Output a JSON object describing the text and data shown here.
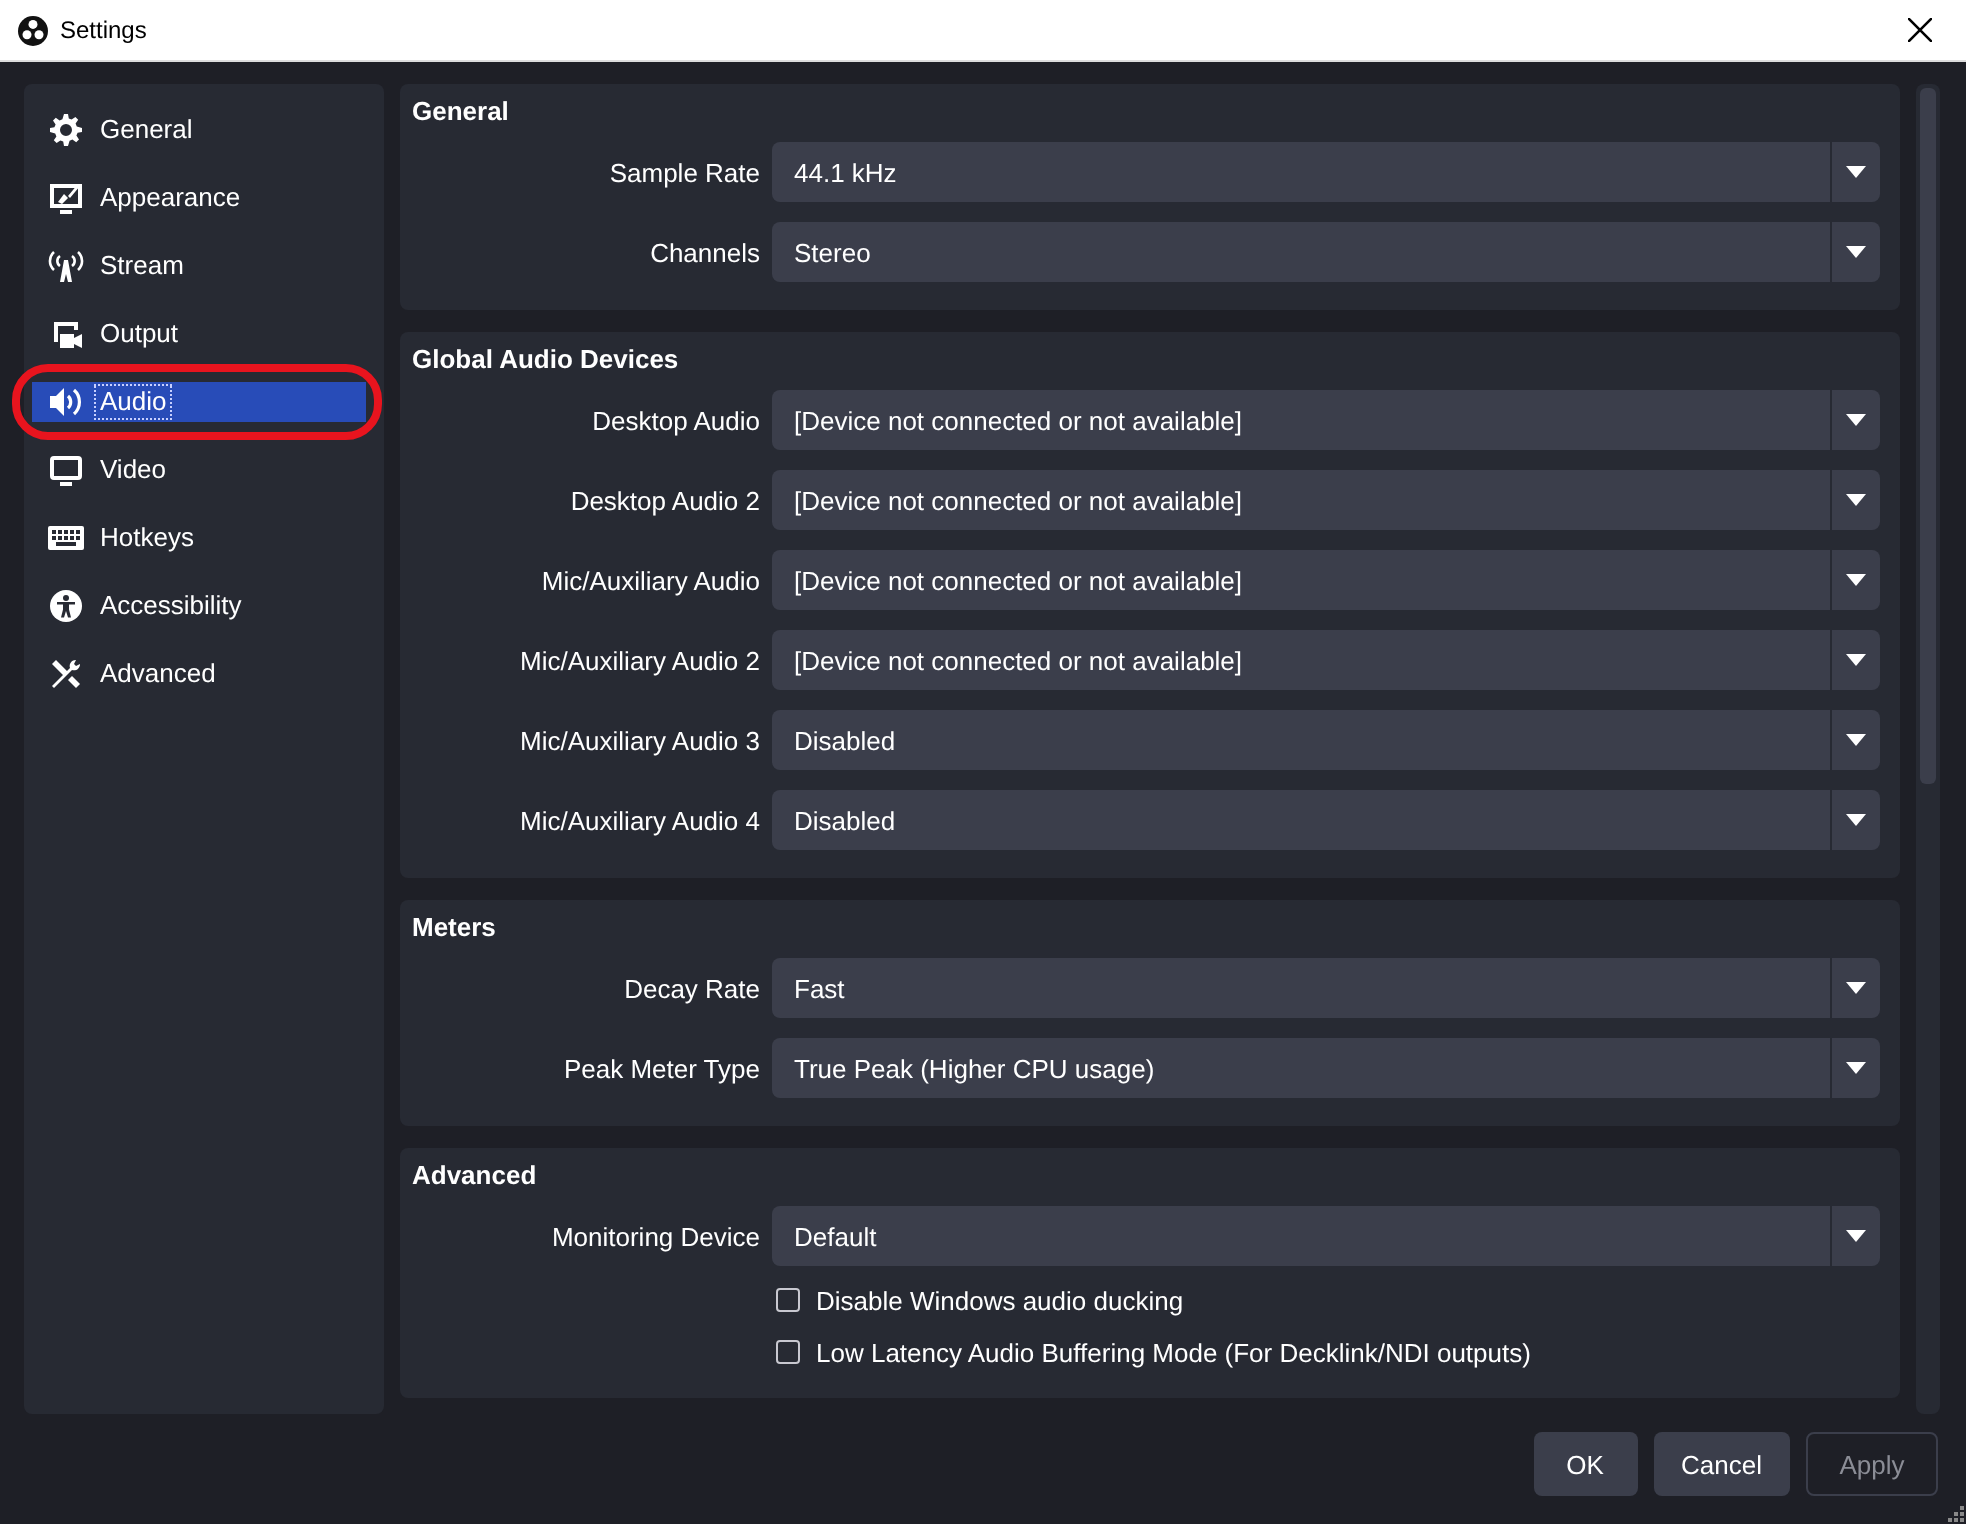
{
  "window": {
    "title": "Settings"
  },
  "sidebar": {
    "items": [
      {
        "label": "General",
        "kind": "gear",
        "selected": false,
        "circled": false
      },
      {
        "label": "Appearance",
        "kind": "monitor-brush",
        "selected": false,
        "circled": false
      },
      {
        "label": "Stream",
        "kind": "antenna",
        "selected": false,
        "circled": false
      },
      {
        "label": "Output",
        "kind": "camera",
        "selected": false,
        "circled": false
      },
      {
        "label": "Audio",
        "kind": "speaker",
        "selected": true,
        "circled": true
      },
      {
        "label": "Video",
        "kind": "monitor",
        "selected": false,
        "circled": false
      },
      {
        "label": "Hotkeys",
        "kind": "keyboard",
        "selected": false,
        "circled": false
      },
      {
        "label": "Accessibility",
        "kind": "person",
        "selected": false,
        "circled": false
      },
      {
        "label": "Advanced",
        "kind": "tools",
        "selected": false,
        "circled": false
      }
    ]
  },
  "sections": [
    {
      "title": "General",
      "rows": [
        {
          "kind": "combo",
          "label": "Sample Rate",
          "value": "44.1 kHz"
        },
        {
          "kind": "combo",
          "label": "Channels",
          "value": "Stereo"
        }
      ]
    },
    {
      "title": "Global Audio Devices",
      "rows": [
        {
          "kind": "combo",
          "label": "Desktop Audio",
          "value": "[Device not connected or not available]"
        },
        {
          "kind": "combo",
          "label": "Desktop Audio 2",
          "value": "[Device not connected or not available]"
        },
        {
          "kind": "combo",
          "label": "Mic/Auxiliary Audio",
          "value": "[Device not connected or not available]"
        },
        {
          "kind": "combo",
          "label": "Mic/Auxiliary Audio 2",
          "value": "[Device not connected or not available]"
        },
        {
          "kind": "combo",
          "label": "Mic/Auxiliary Audio 3",
          "value": "Disabled"
        },
        {
          "kind": "combo",
          "label": "Mic/Auxiliary Audio 4",
          "value": "Disabled"
        }
      ]
    },
    {
      "title": "Meters",
      "rows": [
        {
          "kind": "combo",
          "label": "Decay Rate",
          "value": "Fast"
        },
        {
          "kind": "combo",
          "label": "Peak Meter Type",
          "value": "True Peak (Higher CPU usage)"
        }
      ]
    },
    {
      "title": "Advanced",
      "rows": [
        {
          "kind": "combo",
          "label": "Monitoring Device",
          "value": "Default"
        },
        {
          "kind": "checkbox",
          "label": "Disable Windows audio ducking",
          "checked": false
        },
        {
          "kind": "checkbox",
          "label": "Low Latency Audio Buffering Mode (For Decklink/NDI outputs)",
          "checked": false
        }
      ]
    }
  ],
  "buttons": [
    {
      "label": "OK",
      "disabled": false
    },
    {
      "label": "Cancel",
      "disabled": false
    },
    {
      "label": "Apply",
      "disabled": true
    }
  ]
}
